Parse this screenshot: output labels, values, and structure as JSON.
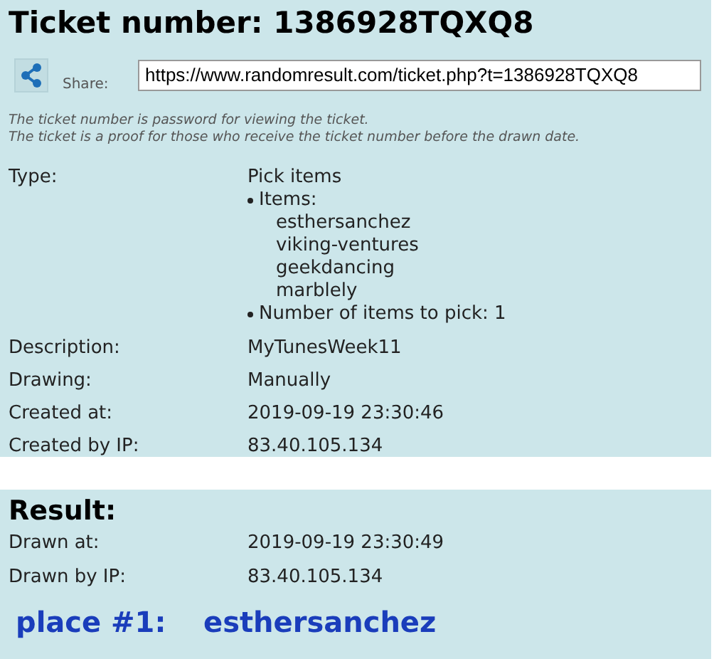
{
  "ticket": {
    "title": "Ticket number: 1386928TQXQ8",
    "share_label": "Share:",
    "share_url": "https://www.randomresult.com/ticket.php?t=1386928TQXQ8",
    "notes": [
      "The ticket number is password for viewing the ticket.",
      "The ticket is a proof for those who receive the ticket number before the drawn date."
    ],
    "type": {
      "label": "Type:",
      "value": "Pick items",
      "items_label": "Items:",
      "items": [
        "esthersanchez",
        "viking-ventures",
        "geekdancing",
        "marblely"
      ],
      "count": "Number of items to pick: 1"
    },
    "rows": [
      {
        "label": "Description:",
        "value": "MyTunesWeek11"
      },
      {
        "label": "Drawing:",
        "value": "Manually"
      },
      {
        "label": "Created at:",
        "value": "2019-09-19 23:30:46"
      },
      {
        "label": "Created by IP:",
        "value": "83.40.105.134"
      }
    ]
  },
  "result": {
    "title": "Result:",
    "rows": [
      {
        "label": "Drawn at:",
        "value": "2019-09-19 23:30:49"
      },
      {
        "label": "Drawn by IP:",
        "value": "83.40.105.134"
      }
    ],
    "places": [
      {
        "place": "place #1:",
        "winner": "esthersanchez"
      }
    ]
  }
}
